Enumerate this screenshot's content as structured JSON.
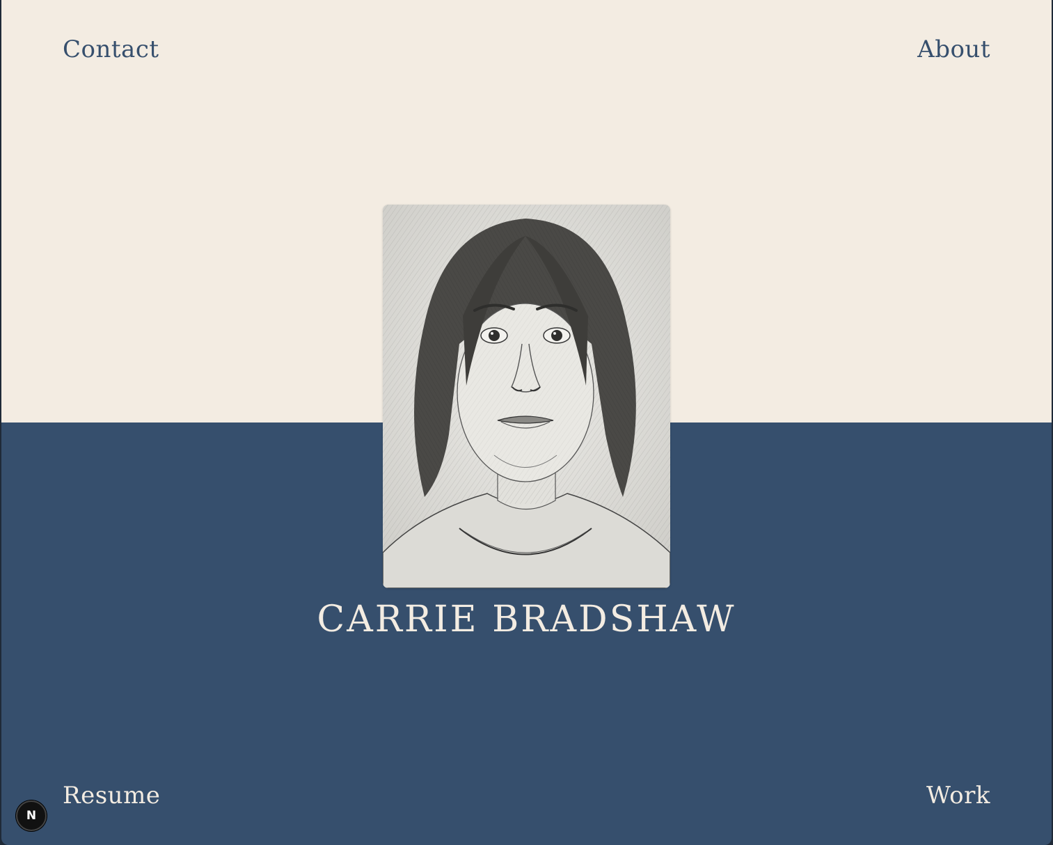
{
  "nav": {
    "contact": "Contact",
    "about": "About",
    "resume": "Resume",
    "work": "Work"
  },
  "hero": {
    "name": "CARRIE BRADSHAW",
    "portrait_icon": "pencil-sketch-portrait"
  },
  "devtools": {
    "badge_label": "N",
    "icon": "nextjs-logo-icon"
  },
  "colors": {
    "top_background": "#f3ece2",
    "bottom_background": "#364f6d",
    "nav_dark": "#364f6d",
    "nav_light": "#f3ece2"
  }
}
